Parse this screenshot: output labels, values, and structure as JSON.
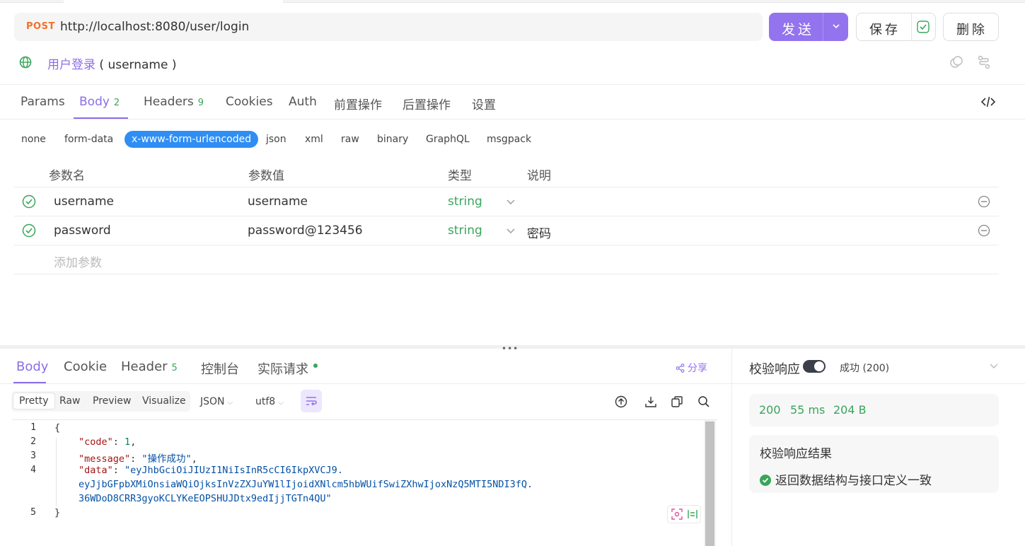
{
  "request": {
    "method": "POST",
    "url": "http://localhost:8080/user/login",
    "send_label": "发送",
    "save_label": "保存",
    "delete_label": "删除",
    "name": "用户登录",
    "name_suffix": "( username )"
  },
  "request_tabs": [
    {
      "label": "Params"
    },
    {
      "label": "Body",
      "count": "2"
    },
    {
      "label": "Headers",
      "count": "9"
    },
    {
      "label": "Cookies"
    },
    {
      "label": "Auth"
    },
    {
      "label": "前置操作"
    },
    {
      "label": "后置操作"
    },
    {
      "label": "设置"
    }
  ],
  "body_types": [
    "none",
    "form-data",
    "x-www-form-urlencoded",
    "json",
    "xml",
    "raw",
    "binary",
    "GraphQL",
    "msgpack"
  ],
  "body_type_selected": "x-www-form-urlencoded",
  "param_table": {
    "headers": [
      "参数名",
      "参数值",
      "类型",
      "说明"
    ],
    "rows": [
      {
        "name": "username",
        "value": "username",
        "type": "string",
        "desc": ""
      },
      {
        "name": "password",
        "value": "password@123456",
        "type": "string",
        "desc": "密码"
      }
    ],
    "add_placeholder": "添加参数"
  },
  "response_tabs": [
    {
      "label": "Body"
    },
    {
      "label": "Cookie"
    },
    {
      "label": "Header",
      "count": "5"
    },
    {
      "label": "控制台"
    },
    {
      "label": "实际请求"
    }
  ],
  "share_label": "分享",
  "view_modes": [
    "Pretty",
    "Raw",
    "Preview",
    "Visualize"
  ],
  "view_selected": "Pretty",
  "format": "JSON",
  "encoding": "utf8",
  "code": {
    "line_numbers": [
      "1",
      "2",
      "3",
      "4",
      "5"
    ],
    "open_brace": "{",
    "close_brace": "}",
    "code_key": "\"code\"",
    "code_value": "1",
    "message_key": "\"message\"",
    "message_value": "\"操作成功\"",
    "data_key": "\"data\"",
    "data_value_1": "\"eyJhbGciOiJIUzI1NiIsInR5cCI6IkpXVCJ9.",
    "data_value_2": "eyJjbGFpbXMiOnsiaWQiOjksInVzZXJuYW1lIjoidXNlcm5hbWUifSwiZXhwIjoxNzQ5MTI5NDI3fQ.",
    "data_value_3": "36WDoD8CRR3gyoKCLYKeEOPSHUJDtx9edIjjTGTn4QU\""
  },
  "validation": {
    "title": "校验响应",
    "status": "成功 (200)",
    "status_code": "200",
    "time": "55 ms",
    "size": "204 B",
    "result_title": "校验响应结果",
    "result_text": "返回数据结构与接口定义一致"
  },
  "colors": {
    "accent": "#9373ee",
    "success": "#3aa55b",
    "method": "#f5702a",
    "selected_pill": "#2f8ef4"
  }
}
